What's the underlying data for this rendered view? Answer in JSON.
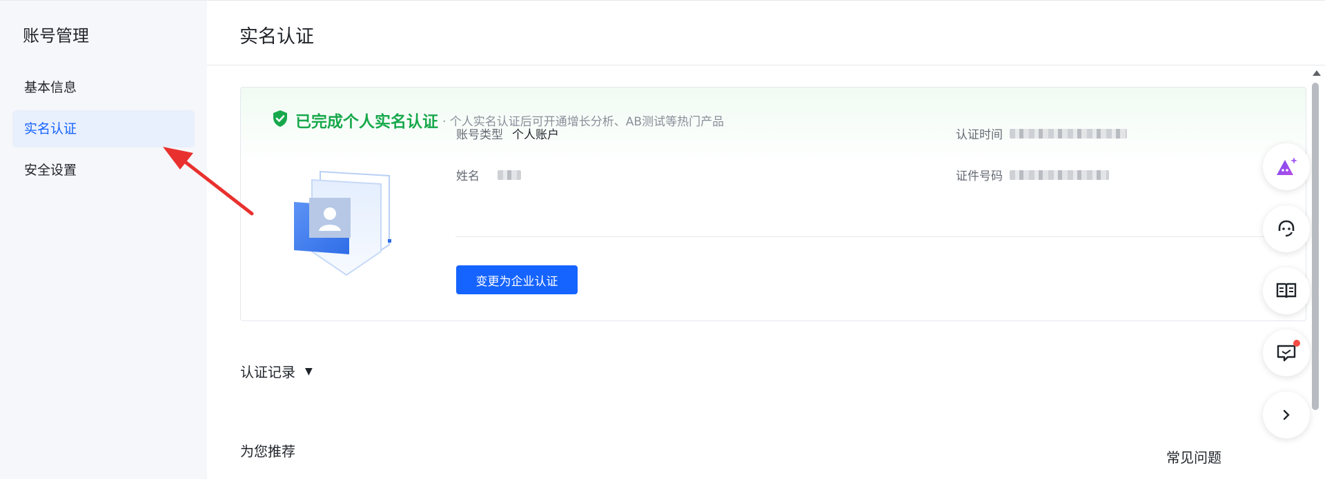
{
  "sidebar": {
    "title": "账号管理",
    "items": [
      {
        "label": "基本信息",
        "active": false
      },
      {
        "label": "实名认证",
        "active": true
      },
      {
        "label": "安全设置",
        "active": false
      }
    ]
  },
  "header": {
    "title": "实名认证"
  },
  "verification": {
    "status_title": "已完成个人实名认证",
    "status_desc": "· 个人实名认证后可开通增长分析、AB测试等热门产品",
    "fields": {
      "account_type_label": "账号类型",
      "account_type_value": "个人账户",
      "name_label": "姓名",
      "verify_time_label": "认证时间",
      "id_number_label": "证件号码"
    },
    "change_button": "变更为企业认证"
  },
  "records": {
    "title": "认证记录"
  },
  "recommend": {
    "title": "为您推荐"
  },
  "faq": {
    "title": "常见问题"
  },
  "float_bar": {
    "icons": [
      "ai-assistant-icon",
      "customer-service-icon",
      "docs-book-icon",
      "feedback-message-icon",
      "collapse-chevron-icon"
    ]
  },
  "colors": {
    "accent": "#1664ff",
    "success": "#17a84b",
    "annotation_arrow": "#e8312f",
    "notification_dot": "#f54a45"
  }
}
